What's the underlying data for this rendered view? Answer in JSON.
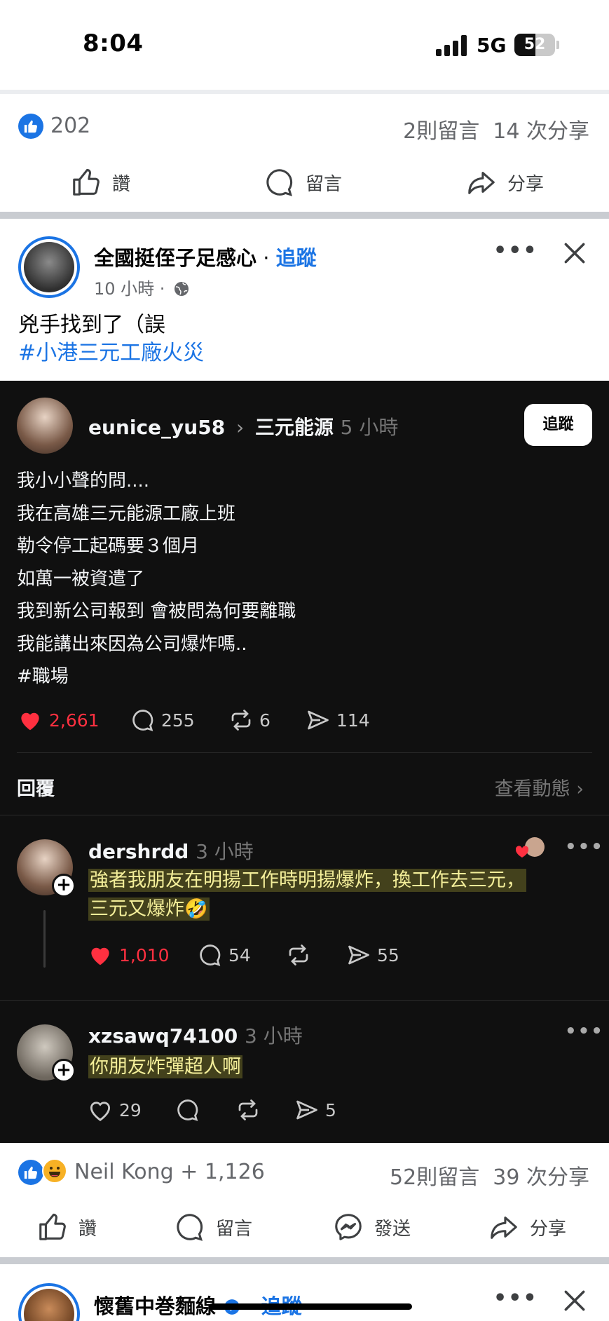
{
  "status_bar": {
    "time": "8:04",
    "network": "5G",
    "battery": "52",
    "battery_level": 0.52
  },
  "prev_post": {
    "like_count": "202",
    "comments": "2則留言",
    "shares": "14 次分享",
    "actions": {
      "like": "讚",
      "comment": "留言",
      "share": "分享"
    }
  },
  "post": {
    "author": "全國挺侄子足感心",
    "separator": " · ",
    "follow": "追蹤",
    "time": "10 小時 ·",
    "text_line1": "兇手找到了（誤",
    "hashtag": "#小港三元工廠火災"
  },
  "threads": {
    "author": "eunice_yu58",
    "arrow": "›",
    "topic": "三元能源",
    "time": "5 小時",
    "follow_button": "追蹤",
    "body": [
      "我小小聲的問....",
      "我在高雄三元能源工廠上班",
      "勒令停工起碼要３個月",
      "如萬一被資遣了",
      "我到新公司報到 會被問為何要離職",
      "我能講出來因為公司爆炸嗎..",
      "#職場"
    ],
    "stats": {
      "likes": "2,661",
      "comments": "255",
      "reposts": "6",
      "shares": "114"
    },
    "replies_label": "回覆",
    "view_activity": "查看動態 ›",
    "reply1": {
      "user": "dershrdd",
      "time": "3 小時",
      "line1": "強者我朋友在明揚工作時明揚爆炸，換工作去三元，",
      "line2": "三元又爆炸🤣",
      "likes": "1,010",
      "comments": "54",
      "shares": "55"
    },
    "reply2": {
      "user": "xzsawq74100",
      "time": "3 小時",
      "text": "你朋友炸彈超人啊",
      "likes": "29",
      "shares": "5"
    }
  },
  "post_footer": {
    "reactors": "Neil Kong + 1,126",
    "comments": "52則留言",
    "shares": "39 次分享",
    "actions": {
      "like": "讚",
      "comment": "留言",
      "send": "發送",
      "share": "分享"
    }
  },
  "next_post": {
    "author": "懷舊中巻麵線",
    "follow": "追蹤"
  },
  "colors": {
    "fb_blue": "#1b74e4",
    "threads_bg": "#101010",
    "heart_red": "#ff3040",
    "highlight": "#f4ef9a"
  }
}
